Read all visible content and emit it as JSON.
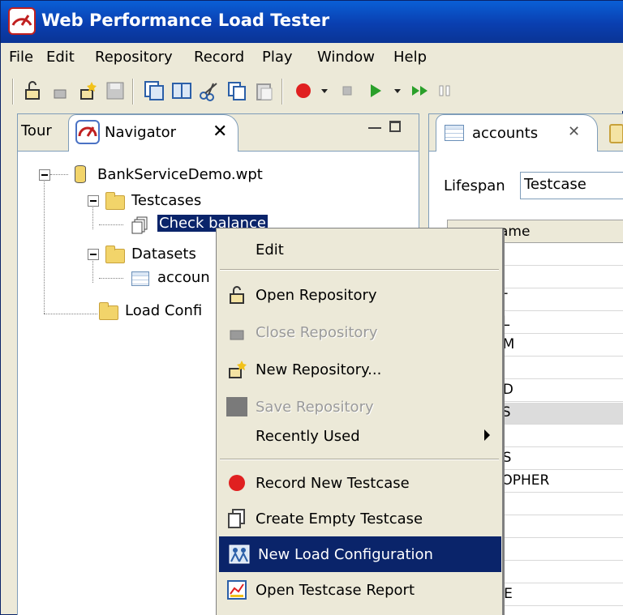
{
  "window": {
    "title": "Web Performance Load Tester"
  },
  "menubar": [
    "File",
    "Edit",
    "Repository",
    "Record",
    "Play",
    "Window",
    "Help"
  ],
  "navigator": {
    "tabs": {
      "tour": "Tour",
      "navigator": "Navigator"
    },
    "tree": {
      "root": "BankServiceDemo.wpt",
      "testcases": "Testcases",
      "check_balance": "Check balance",
      "datasets": "Datasets",
      "accounts": "accoun",
      "load_configs": "Load Confi"
    }
  },
  "editor": {
    "tab_label": "accounts",
    "lifespan_label": "Lifespan",
    "lifespan_value": "Testcase",
    "column_header": "ame",
    "rows": [
      "",
      "",
      "LT",
      "EL",
      "AM",
      "",
      "RD",
      "ES",
      "H",
      "AS",
      "TOPHER",
      "",
      "",
      "",
      "D",
      "GE"
    ],
    "highlighted_row": 7
  },
  "context_menu": {
    "edit": "Edit",
    "open_repository": "Open Repository",
    "close_repository": "Close Repository",
    "new_repository": "New Repository...",
    "save_repository": "Save Repository",
    "recently_used": "Recently Used",
    "record_new_testcase": "Record New Testcase",
    "create_empty_testcase": "Create Empty Testcase",
    "new_load_configuration": "New Load Configuration",
    "open_testcase_report": "Open Testcase Report"
  },
  "colors": {
    "selection": "#0a246a",
    "record_red": "#e02020",
    "play_green": "#2aa02a"
  }
}
